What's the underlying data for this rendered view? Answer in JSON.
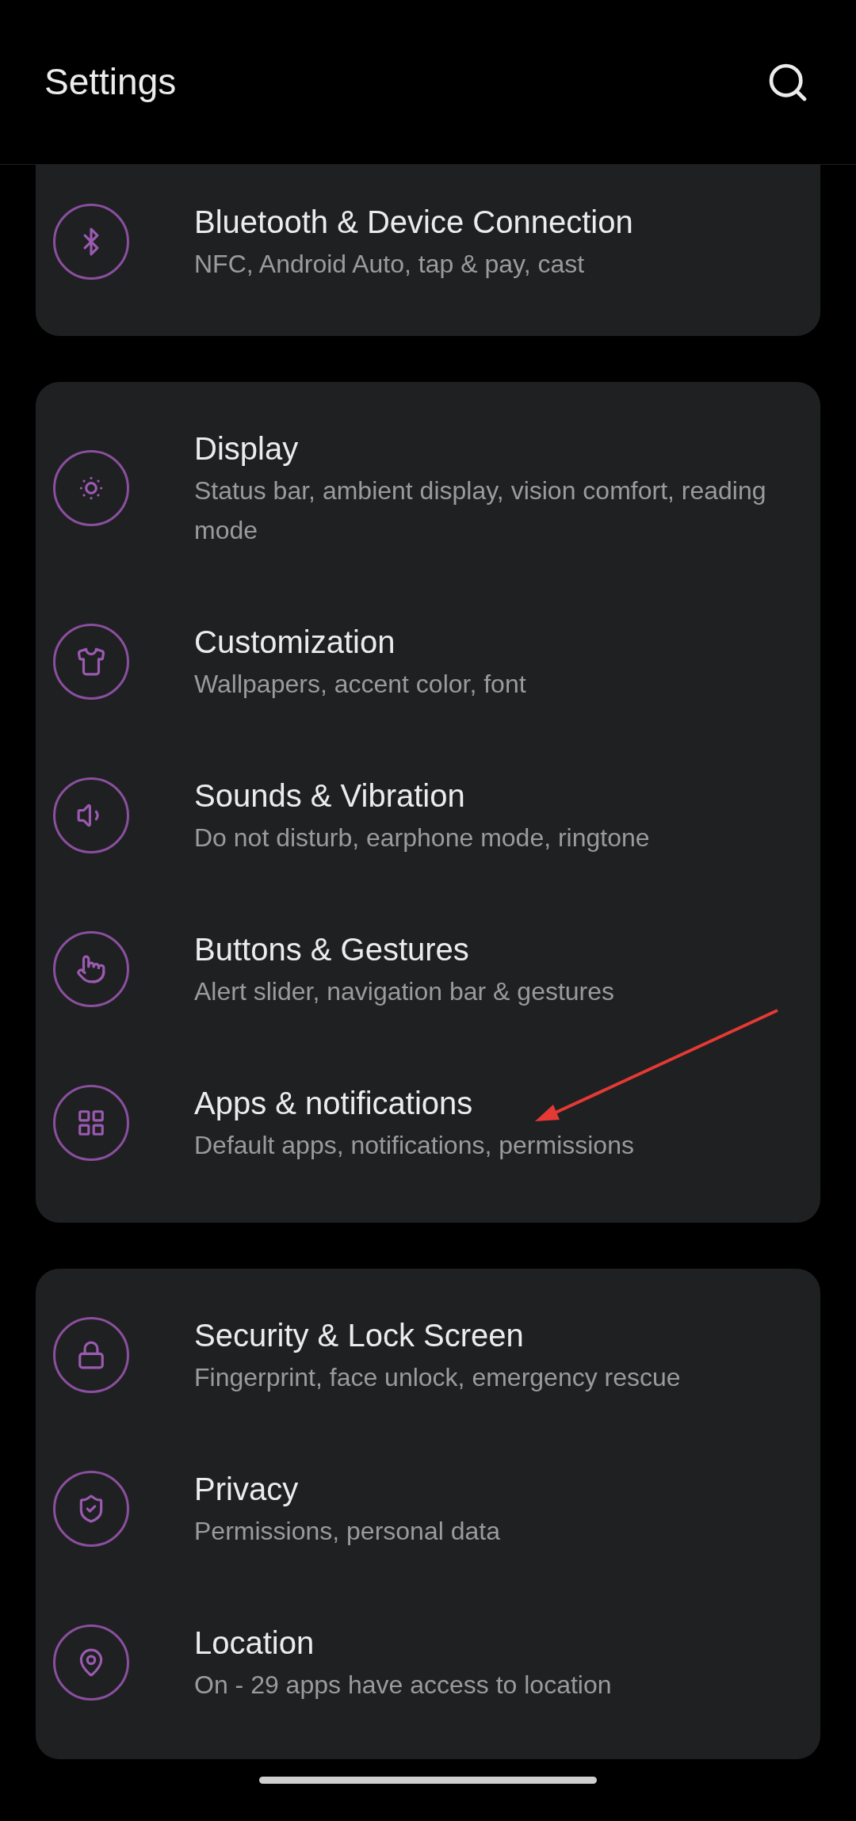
{
  "header": {
    "title": "Settings"
  },
  "groups": [
    {
      "items": [
        {
          "title": "Bluetooth & Device Connection",
          "subtitle": "NFC, Android Auto, tap & pay, cast"
        }
      ]
    },
    {
      "items": [
        {
          "title": "Display",
          "subtitle": "Status bar, ambient display, vision comfort, reading mode"
        },
        {
          "title": "Customization",
          "subtitle": "Wallpapers, accent color, font"
        },
        {
          "title": "Sounds & Vibration",
          "subtitle": "Do not disturb, earphone mode, ringtone"
        },
        {
          "title": "Buttons & Gestures",
          "subtitle": "Alert slider, navigation bar & gestures"
        },
        {
          "title": "Apps & notifications",
          "subtitle": "Default apps, notifications, permissions"
        }
      ]
    },
    {
      "items": [
        {
          "title": "Security & Lock Screen",
          "subtitle": "Fingerprint, face unlock, emergency rescue"
        },
        {
          "title": "Privacy",
          "subtitle": "Permissions, personal data"
        },
        {
          "title": "Location",
          "subtitle": "On - 29 apps have access to location"
        }
      ]
    }
  ]
}
